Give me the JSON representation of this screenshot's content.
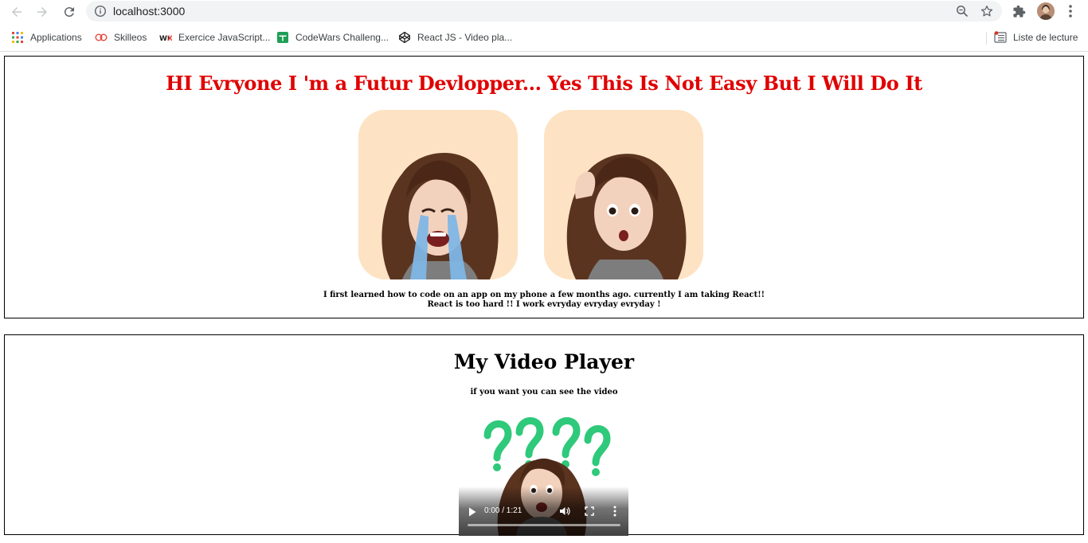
{
  "browser": {
    "url": "localhost:3000",
    "bookmarks": [
      {
        "label": "Applications",
        "icon": "apps-grid-icon"
      },
      {
        "label": "Skilleos",
        "icon": "skilleos-icon"
      },
      {
        "label": "Exercice JavaScript...",
        "icon": "wix-icon"
      },
      {
        "label": "CodeWars Challeng...",
        "icon": "sheets-icon"
      },
      {
        "label": "React JS - Video pla...",
        "icon": "codepen-icon"
      }
    ],
    "reading_list": "Liste de lecture"
  },
  "intro_section": {
    "title": "HI Evryone I 'm a Futur Devlopper... Yes This Is Not Easy But I Will Do It",
    "text_line1": "I first learned how to code on an app on my phone a few months ago. currently I am taking React!!",
    "text_line2": "React is too hard !! I work evryday evryday evryday !",
    "title_color": "#e00000",
    "image_bg": "#fde3c4"
  },
  "video_section": {
    "title": "My Video Player",
    "subtitle": "if you want you can see the video",
    "player": {
      "time": "0:00 / 1:21",
      "progress": 0.0
    }
  }
}
